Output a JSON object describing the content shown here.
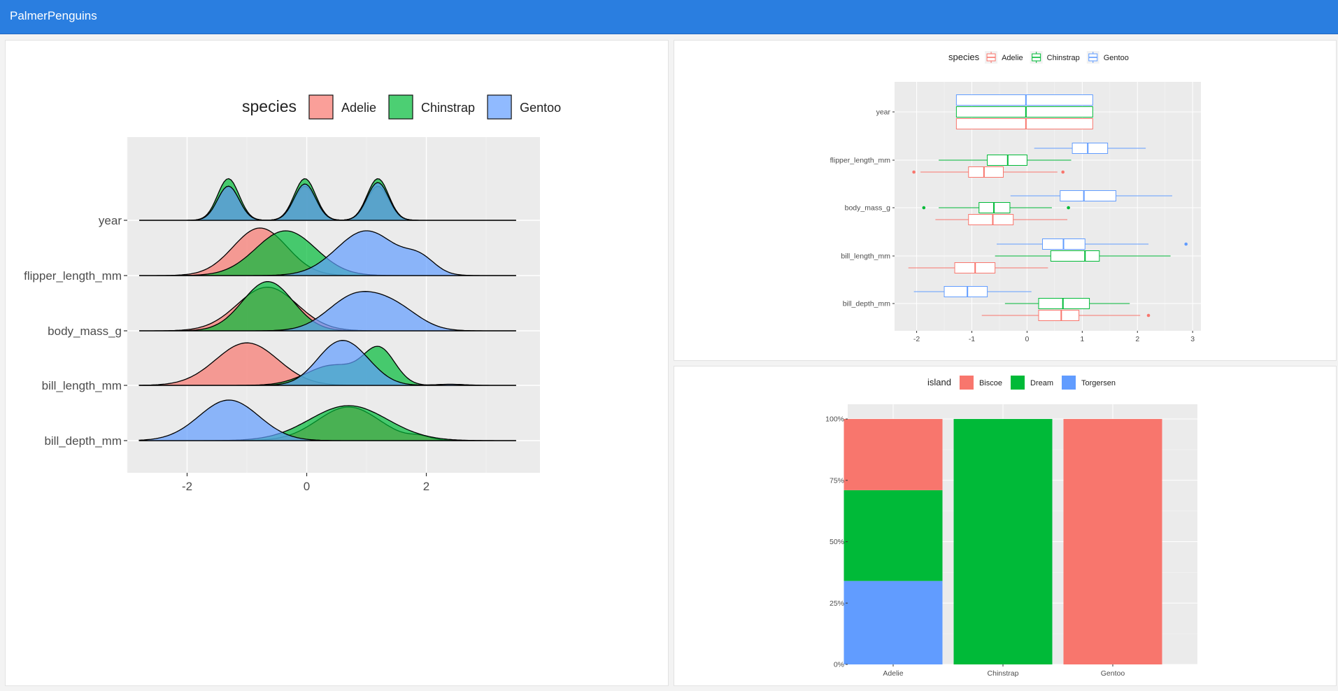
{
  "app": {
    "title": "PalmerPenguins"
  },
  "colors": {
    "Adelie": "#f8766d",
    "Chinstrap": "#00ba38",
    "Gentoo": "#619cff",
    "Biscoe": "#f8766d",
    "Dream": "#00ba38",
    "Torgersen": "#619cff",
    "topbar": "#2a7ee0",
    "plot_bg": "#ebebeb"
  },
  "chart_data": [
    {
      "id": "ridgeline",
      "type": "area",
      "legend": {
        "title": "species",
        "position": "top",
        "entries": [
          "Adelie",
          "Chinstrap",
          "Gentoo"
        ]
      },
      "xlim": [
        -3.0,
        3.9
      ],
      "xticks": [
        "-2",
        "0",
        "2"
      ],
      "yticks": [
        "year",
        "flipper_length_mm",
        "body_mass_g",
        "bill_length_mm",
        "bill_depth_mm"
      ],
      "xrange": [
        -2.8,
        3.5
      ],
      "grid": true,
      "series": [
        {
          "name": "Adelie",
          "rows": {
            "year": [
              [
                -1.31,
                1.22,
                0.18
              ],
              [
                -0.03,
                1.22,
                0.18
              ],
              [
                1.19,
                1.22,
                0.18
              ]
            ],
            "flipper_length_mm": [
              [
                -0.78,
                1.7,
                0.45
              ]
            ],
            "body_mass_g": [
              [
                -0.66,
                1.56,
                0.5
              ]
            ],
            "bill_length_mm": [
              [
                -1.0,
                1.52,
                0.52
              ]
            ],
            "bill_depth_mm": [
              [
                0.7,
                1.2,
                0.52
              ],
              [
                1.9,
                0.12,
                0.18
              ]
            ]
          }
        },
        {
          "name": "Chinstrap",
          "rows": {
            "year": [
              [
                -1.31,
                1.49,
                0.18
              ],
              [
                -0.03,
                1.49,
                0.18
              ],
              [
                1.19,
                1.49,
                0.18
              ]
            ],
            "flipper_length_mm": [
              [
                -0.35,
                1.6,
                0.5
              ]
            ],
            "body_mass_g": [
              [
                -0.65,
                1.76,
                0.42
              ]
            ],
            "bill_length_mm": [
              [
                1.22,
                1.22,
                0.26
              ],
              [
                0.45,
                0.72,
                0.45
              ]
            ],
            "bill_depth_mm": [
              [
                0.7,
                1.25,
                0.65
              ]
            ]
          }
        },
        {
          "name": "Gentoo",
          "rows": {
            "year": [
              [
                -1.31,
                1.22,
                0.18
              ],
              [
                -0.03,
                1.3,
                0.18
              ],
              [
                1.19,
                1.35,
                0.18
              ]
            ],
            "flipper_length_mm": [
              [
                1.0,
                1.6,
                0.5
              ],
              [
                1.9,
                0.5,
                0.25
              ]
            ],
            "body_mass_g": [
              [
                0.8,
                1.2,
                0.45
              ],
              [
                1.5,
                0.7,
                0.4
              ]
            ],
            "bill_length_mm": [
              [
                0.45,
                1.1,
                0.35
              ],
              [
                0.85,
                0.78,
                0.35
              ],
              [
                2.4,
                0.04,
                0.25
              ]
            ],
            "bill_depth_mm": [
              [
                -1.3,
                1.45,
                0.5
              ]
            ]
          }
        }
      ]
    },
    {
      "id": "boxplot",
      "type": "bar",
      "legend": {
        "title": "species",
        "position": "top",
        "entries": [
          "Adelie",
          "Chinstrap",
          "Gentoo"
        ]
      },
      "xlim": [
        -2.4,
        3.15
      ],
      "xticks": [
        "-2",
        "-1",
        "0",
        "1",
        "2",
        "3"
      ],
      "categories": [
        "year",
        "flipper_length_mm",
        "body_mass_g",
        "bill_length_mm",
        "bill_depth_mm"
      ],
      "grid": true,
      "series": [
        {
          "name": "Adelie",
          "boxes": [
            {
              "lo": -1.28,
              "q1": -1.28,
              "med": -0.02,
              "q3": 1.19,
              "hi": 1.19,
              "out": []
            },
            {
              "lo": -1.93,
              "q1": -1.06,
              "med": -0.78,
              "q3": -0.43,
              "hi": 0.55,
              "out": [
                -2.05,
                0.65
              ]
            },
            {
              "lo": -1.66,
              "q1": -1.06,
              "med": -0.62,
              "q3": -0.25,
              "hi": 0.73,
              "out": []
            },
            {
              "lo": -2.15,
              "q1": -1.31,
              "med": -0.94,
              "q3": -0.58,
              "hi": 0.38,
              "out": []
            },
            {
              "lo": -0.82,
              "q1": 0.21,
              "med": 0.62,
              "q3": 0.94,
              "hi": 2.05,
              "out": [
                2.2
              ]
            }
          ]
        },
        {
          "name": "Chinstrap",
          "boxes": [
            {
              "lo": -1.28,
              "q1": -1.28,
              "med": -0.02,
              "q3": 1.19,
              "hi": 1.19,
              "out": []
            },
            {
              "lo": -1.6,
              "q1": -0.72,
              "med": -0.35,
              "q3": 0.0,
              "hi": 0.8,
              "out": []
            },
            {
              "lo": -1.6,
              "q1": -0.87,
              "med": -0.6,
              "q3": -0.31,
              "hi": 0.45,
              "out": [
                -1.87,
                0.75
              ]
            },
            {
              "lo": -0.58,
              "q1": 0.43,
              "med": 1.05,
              "q3": 1.31,
              "hi": 2.6,
              "out": []
            },
            {
              "lo": -0.4,
              "q1": 0.21,
              "med": 0.65,
              "q3": 1.13,
              "hi": 1.86,
              "out": []
            }
          ]
        },
        {
          "name": "Gentoo",
          "boxes": [
            {
              "lo": -1.28,
              "q1": -1.28,
              "med": -0.02,
              "q3": 1.19,
              "hi": 1.19,
              "out": []
            },
            {
              "lo": 0.13,
              "q1": 0.82,
              "med": 1.1,
              "q3": 1.46,
              "hi": 2.15,
              "out": []
            },
            {
              "lo": -0.3,
              "q1": 0.6,
              "med": 1.03,
              "q3": 1.61,
              "hi": 2.63,
              "out": []
            },
            {
              "lo": -0.55,
              "q1": 0.28,
              "med": 0.66,
              "q3": 1.05,
              "hi": 2.2,
              "out": [
                2.88
              ]
            },
            {
              "lo": -2.05,
              "q1": -1.5,
              "med": -1.08,
              "q3": -0.72,
              "hi": 0.08,
              "out": []
            }
          ]
        }
      ]
    },
    {
      "id": "stacked",
      "type": "bar",
      "legend": {
        "title": "island",
        "position": "top",
        "entries": [
          "Biscoe",
          "Dream",
          "Torgersen"
        ]
      },
      "categories": [
        "Adelie",
        "Chinstrap",
        "Gentoo"
      ],
      "yticks": [
        "0%",
        "25%",
        "50%",
        "75%",
        "100%"
      ],
      "ylim": [
        0,
        1.06
      ],
      "grid": true,
      "series": [
        {
          "name": "Torgersen",
          "values": [
            0.34,
            0,
            0
          ]
        },
        {
          "name": "Dream",
          "values": [
            0.37,
            1,
            0
          ]
        },
        {
          "name": "Biscoe",
          "values": [
            0.29,
            0,
            1
          ]
        }
      ]
    }
  ]
}
